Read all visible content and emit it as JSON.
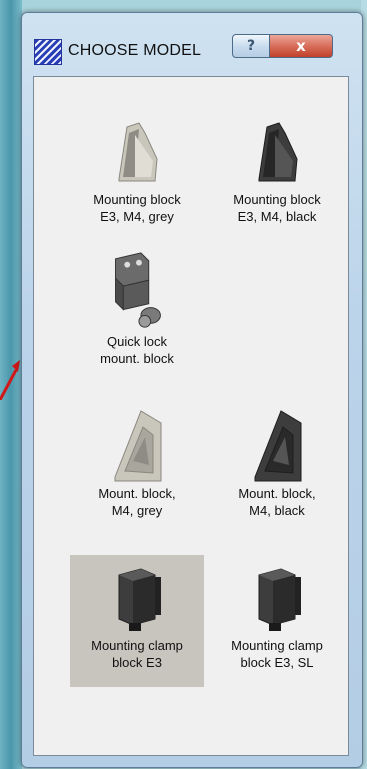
{
  "window": {
    "title": "CHOOSE MODEL",
    "help_label": "?",
    "close_label": "x"
  },
  "models": [
    {
      "line1": "Mounting block",
      "line2": "E3, M4, grey",
      "color": "#c9c6bc",
      "shape": "wedge",
      "selected": false
    },
    {
      "line1": "Mounting block",
      "line2": "E3, M4, black",
      "color": "#3d3d3d",
      "shape": "wedge",
      "selected": false
    },
    {
      "line1": "Quick lock",
      "line2": "mount. block",
      "color": "#5a5a5a",
      "shape": "bracket",
      "selected": false
    },
    {
      "line1": "Mount. block,",
      "line2": "M4, grey",
      "color": "#c9c6bc",
      "shape": "triangle",
      "selected": false
    },
    {
      "line1": "Mount. block,",
      "line2": "M4, black",
      "color": "#3d3d3d",
      "shape": "triangle",
      "selected": false
    },
    {
      "line1": "Mounting clamp",
      "line2": "block E3",
      "color": "#3d3d3d",
      "shape": "clamp",
      "selected": true
    },
    {
      "line1": "Mounting clamp",
      "line2": "block E3, SL",
      "color": "#3d3d3d",
      "shape": "clamp",
      "selected": false
    }
  ]
}
